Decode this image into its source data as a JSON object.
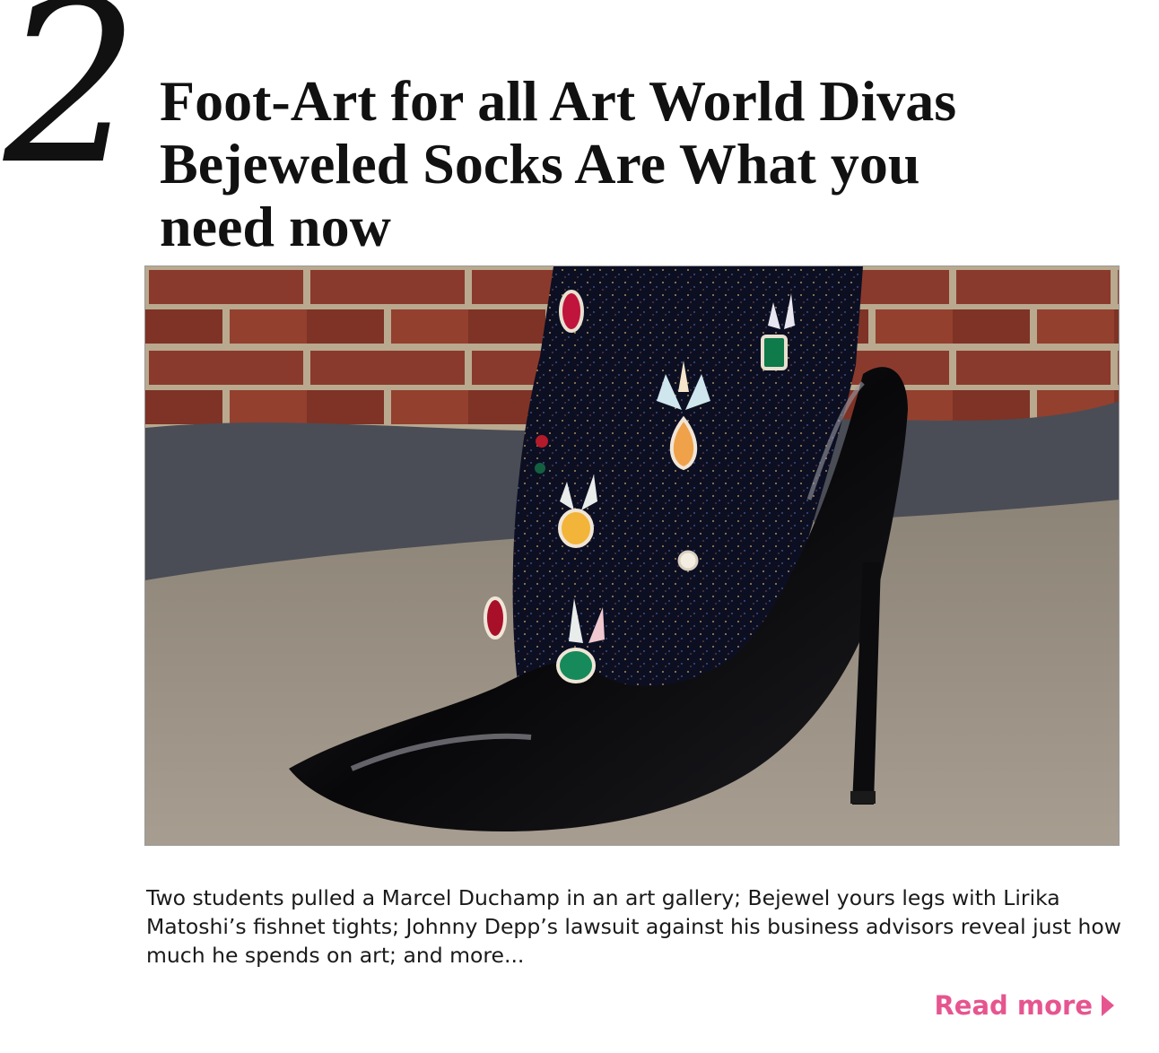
{
  "article": {
    "number": "2",
    "headline_lines": [
      "Foot-Art for all Art World Divas",
      "Bejeweled Socks Are What you",
      "need now"
    ],
    "summary": "Two students pulled a Marcel Duchamp in an art gallery; Bejewel yours legs with Lirika Matoshi’s fishnet tights; Johnny Depp’s lawsuit against his business advisors reveal just how much he spends on art; and more...",
    "read_more_label": "Read more",
    "read_more_icon": "play-triangle-icon"
  },
  "colors": {
    "accent": "#e6558f",
    "text": "#111111",
    "photo_border": "#9a9a9a"
  }
}
